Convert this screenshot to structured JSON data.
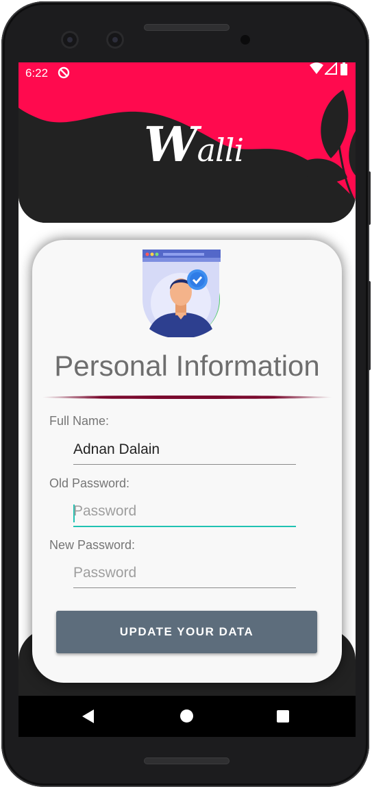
{
  "status_bar": {
    "time": "6:22"
  },
  "app": {
    "logo_initial": "W",
    "logo_rest": "alli"
  },
  "card": {
    "title": "Personal Information",
    "full_name": {
      "label": "Full Name:",
      "value": "Adnan Dalain"
    },
    "old_password": {
      "label": "Old Password:",
      "placeholder": "Password"
    },
    "new_password": {
      "label": "New Password:",
      "placeholder": "Password"
    },
    "update_button": "UPDATE YOUR DATA"
  },
  "colors": {
    "accent_pink": "#ff0a4e",
    "dark": "#222222",
    "button": "#5d6d7c",
    "focus": "#1fc2b2"
  }
}
